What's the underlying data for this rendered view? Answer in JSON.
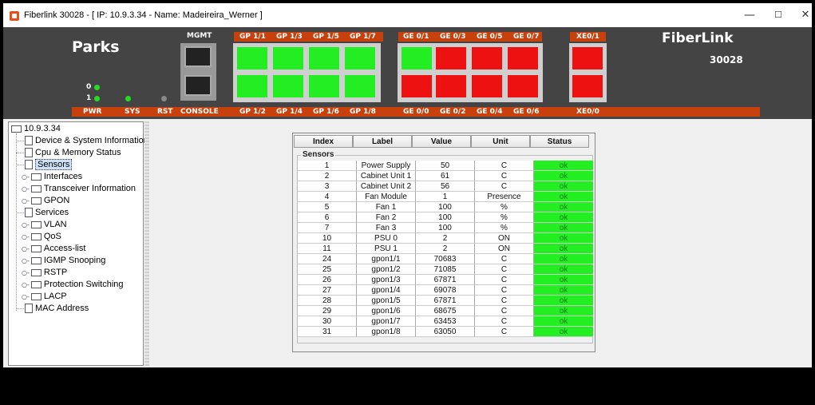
{
  "window": {
    "title": "Fiberlink 30028 - [ IP: 10.9.3.34 - Name: Madeireira_Werner ]",
    "minimize": "—",
    "maximize": "☐",
    "close": "✕"
  },
  "device": {
    "brand": "Parks",
    "product": "FiberLink",
    "model": "30028",
    "mgmt_label": "MGMT",
    "console_label": "CONSOLE",
    "led_labels": {
      "pwr": "PWR",
      "sys": "SYS",
      "rst": "RST",
      "led0": "0",
      "led1": "1"
    },
    "gp_top_labels": [
      "GP 1/1",
      "GP 1/3",
      "GP 1/5",
      "GP 1/7"
    ],
    "gp_bottom_labels": [
      "GP 1/2",
      "GP 1/4",
      "GP 1/6",
      "GP 1/8"
    ],
    "ge_top_labels": [
      "GE 0/1",
      "GE 0/3",
      "GE 0/5",
      "GE 0/7"
    ],
    "ge_bottom_labels": [
      "GE 0/0",
      "GE 0/2",
      "GE 0/4",
      "GE 0/6"
    ],
    "xe_top_label": "XE0/1",
    "xe_bottom_label": "XE0/0",
    "gp_top_status": [
      "up",
      "up",
      "up",
      "up"
    ],
    "gp_bottom_status": [
      "up",
      "up",
      "up",
      "up"
    ],
    "ge_top_status": [
      "up",
      "down",
      "down",
      "down"
    ],
    "ge_bottom_status": [
      "down",
      "down",
      "down",
      "down"
    ],
    "xe_status": [
      "down",
      "down"
    ],
    "colors": {
      "up": "#22ee22",
      "down": "#ee1111",
      "panel": "#444444",
      "bar": "#c8400c"
    }
  },
  "tree": {
    "root": "10.9.3.34",
    "items": [
      {
        "label": "Device & System Information",
        "type": "doc"
      },
      {
        "label": "Cpu & Memory Status",
        "type": "doc"
      },
      {
        "label": "Sensors",
        "type": "doc",
        "selected": true
      },
      {
        "label": "Interfaces",
        "type": "folder"
      },
      {
        "label": "Transceiver Information",
        "type": "folder"
      },
      {
        "label": "GPON",
        "type": "folder"
      },
      {
        "label": "Services",
        "type": "doc"
      },
      {
        "label": "VLAN",
        "type": "folder"
      },
      {
        "label": "QoS",
        "type": "folder"
      },
      {
        "label": "Access-list",
        "type": "folder"
      },
      {
        "label": "IGMP Snooping",
        "type": "folder"
      },
      {
        "label": "RSTP",
        "type": "folder"
      },
      {
        "label": "Protection Switching",
        "type": "folder"
      },
      {
        "label": "LACP",
        "type": "folder"
      },
      {
        "label": "MAC Address",
        "type": "doc"
      }
    ]
  },
  "table": {
    "headers": [
      "Index",
      "Label",
      "Value",
      "Unit",
      "Status"
    ],
    "group_title": "Sensors",
    "rows": [
      [
        "1",
        "Power Supply",
        "50",
        "C",
        "ok"
      ],
      [
        "2",
        "Cabinet Unit 1",
        "61",
        "C",
        "ok"
      ],
      [
        "3",
        "Cabinet Unit 2",
        "56",
        "C",
        "ok"
      ],
      [
        "4",
        "Fan Module",
        "1",
        "Presence",
        "ok"
      ],
      [
        "5",
        "Fan 1",
        "100",
        "%",
        "ok"
      ],
      [
        "6",
        "Fan 2",
        "100",
        "%",
        "ok"
      ],
      [
        "7",
        "Fan 3",
        "100",
        "%",
        "ok"
      ],
      [
        "10",
        "PSU 0",
        "2",
        "ON",
        "ok"
      ],
      [
        "11",
        "PSU 1",
        "2",
        "ON",
        "ok"
      ],
      [
        "24",
        "gpon1/1",
        "70683",
        "C",
        "ok"
      ],
      [
        "25",
        "gpon1/2",
        "71085",
        "C",
        "ok"
      ],
      [
        "26",
        "gpon1/3",
        "67871",
        "C",
        "ok"
      ],
      [
        "27",
        "gpon1/4",
        "69078",
        "C",
        "ok"
      ],
      [
        "28",
        "gpon1/5",
        "67871",
        "C",
        "ok"
      ],
      [
        "29",
        "gpon1/6",
        "68675",
        "C",
        "ok"
      ],
      [
        "30",
        "gpon1/7",
        "63453",
        "C",
        "ok"
      ],
      [
        "31",
        "gpon1/8",
        "63050",
        "C",
        "ok"
      ]
    ]
  }
}
